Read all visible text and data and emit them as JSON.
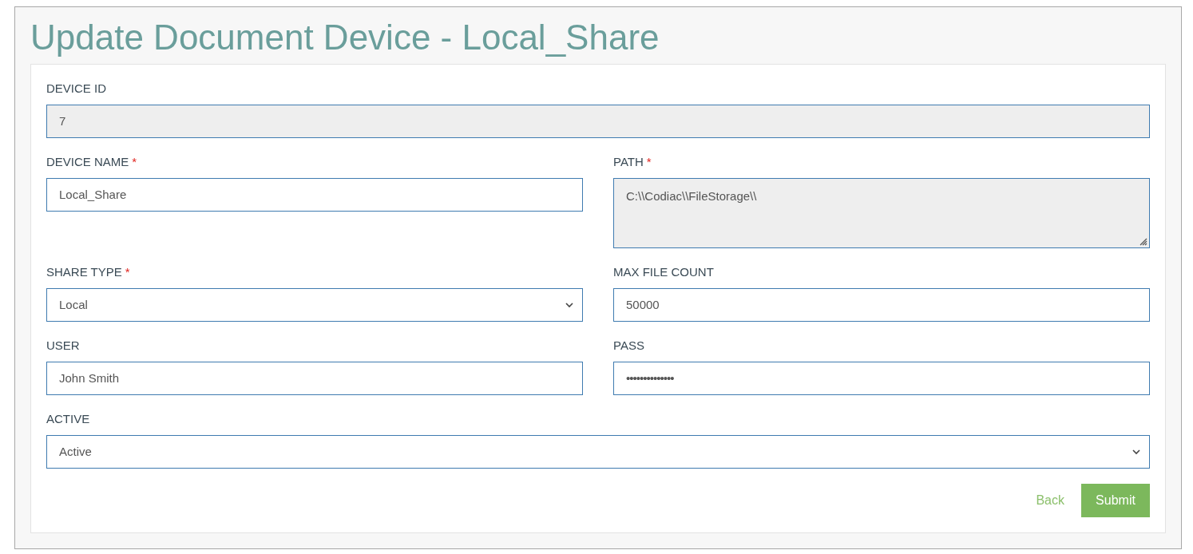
{
  "title": "Update Document Device - Local_Share",
  "rows": [
    [
      {
        "label": "DEVICE ID",
        "kind": "text",
        "value": "7",
        "disabled": true
      }
    ],
    [
      {
        "label": "DEVICE NAME",
        "required_mark": "*",
        "kind": "text",
        "value": "Local_Share",
        "disabled": false
      },
      {
        "label": "PATH",
        "required_mark": "*",
        "kind": "textarea",
        "value": "C:\\\\Codiac\\\\FileStorage\\\\",
        "disabled": true
      }
    ],
    [
      {
        "label": "SHARE TYPE",
        "required_mark": "*",
        "kind": "select",
        "value": "Local",
        "disabled": false
      },
      {
        "label": "MAX FILE COUNT",
        "kind": "text",
        "value": "50000",
        "disabled": false
      }
    ],
    [
      {
        "label": "USER",
        "kind": "text",
        "value": "John Smith",
        "disabled": false
      },
      {
        "label": "PASS",
        "kind": "password",
        "value": "••••••••••••••",
        "disabled": false
      }
    ],
    [
      {
        "label": "ACTIVE",
        "kind": "select",
        "value": "Active",
        "disabled": false
      }
    ]
  ],
  "actions": {
    "back": "Back",
    "submit": "Submit"
  }
}
